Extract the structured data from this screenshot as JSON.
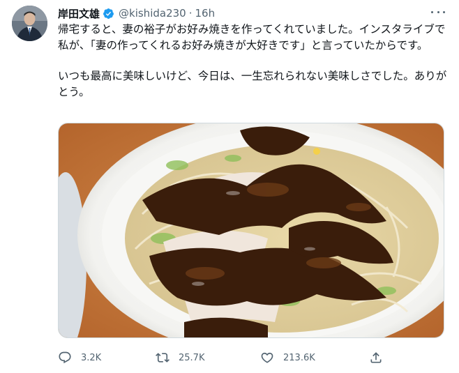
{
  "tweet": {
    "author_name": "岸田文雄",
    "author_handle": "@kishida230",
    "separator": "·",
    "time_ago": "16h",
    "paragraphs": [
      "帰宅すると、妻の裕子がお好み焼きを作ってくれていました。インスタライブで私が、「妻の作ってくれるお好み焼きが大好きです」と言っていたからです。",
      "いつも最高に美味しいけど、今日は、一生忘れられない美味しさでした。ありがとう。"
    ]
  },
  "metrics": {
    "replies": "3.2K",
    "retweets": "25.7K",
    "likes": "213.6K"
  },
  "icons": {
    "avatar": "avatar-portrait",
    "verified": "verified-badge-icon",
    "more": "more-options-icon",
    "reply": "reply-icon",
    "retweet": "retweet-icon",
    "like": "heart-icon",
    "share": "share-icon"
  },
  "colors": {
    "verified_blue": "#1d9bf0",
    "secondary_text": "#536471",
    "primary_text": "#0f1419",
    "border": "#cfd9de"
  }
}
